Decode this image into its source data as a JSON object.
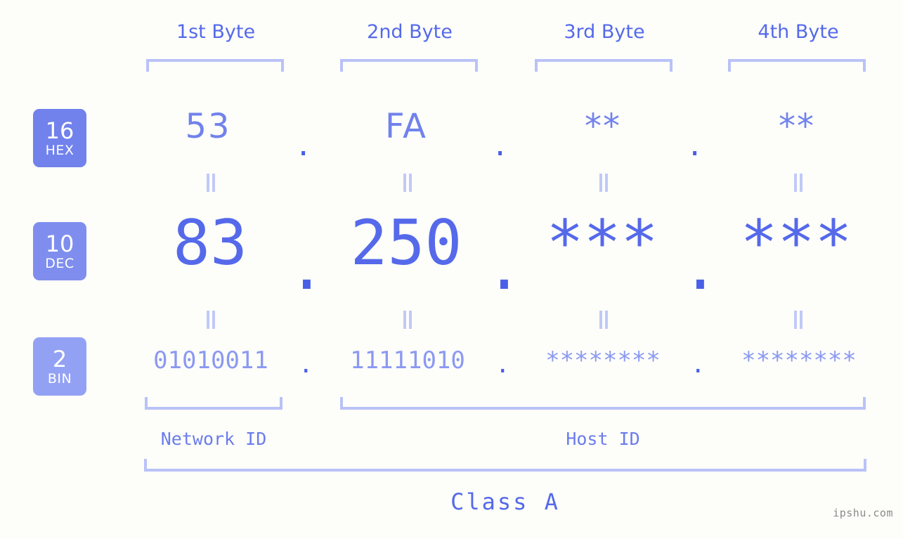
{
  "meta": {
    "background_color": "#fdfefa",
    "accent_color": "#5569ea",
    "accent_light_color": "#b9c2f7",
    "badge_colors": [
      "#7182ec",
      "#7f8eee",
      "#93a1f4"
    ]
  },
  "watermark": "ipshu.com",
  "byte_headers": [
    {
      "label": "1st Byte"
    },
    {
      "label": "2nd Byte"
    },
    {
      "label": "3rd Byte"
    },
    {
      "label": "4th Byte"
    }
  ],
  "radix_rows": [
    {
      "id": "hex",
      "base": "16",
      "name": "HEX",
      "values": [
        "53",
        "FA",
        "**",
        "**"
      ],
      "separator": "."
    },
    {
      "id": "dec",
      "base": "10",
      "name": "DEC",
      "values": [
        "83",
        "250",
        "***",
        "***"
      ],
      "separator": "."
    },
    {
      "id": "bin",
      "base": "2",
      "name": "BIN",
      "values": [
        "01010011",
        "11111010",
        "********",
        "********"
      ],
      "separator": "."
    }
  ],
  "equality_marks": {
    "glyph": "=",
    "count_per_row": 4,
    "rows": 2
  },
  "id_captions": [
    {
      "label": "Network ID"
    },
    {
      "label": "Host ID"
    }
  ],
  "class_caption": "Class A"
}
